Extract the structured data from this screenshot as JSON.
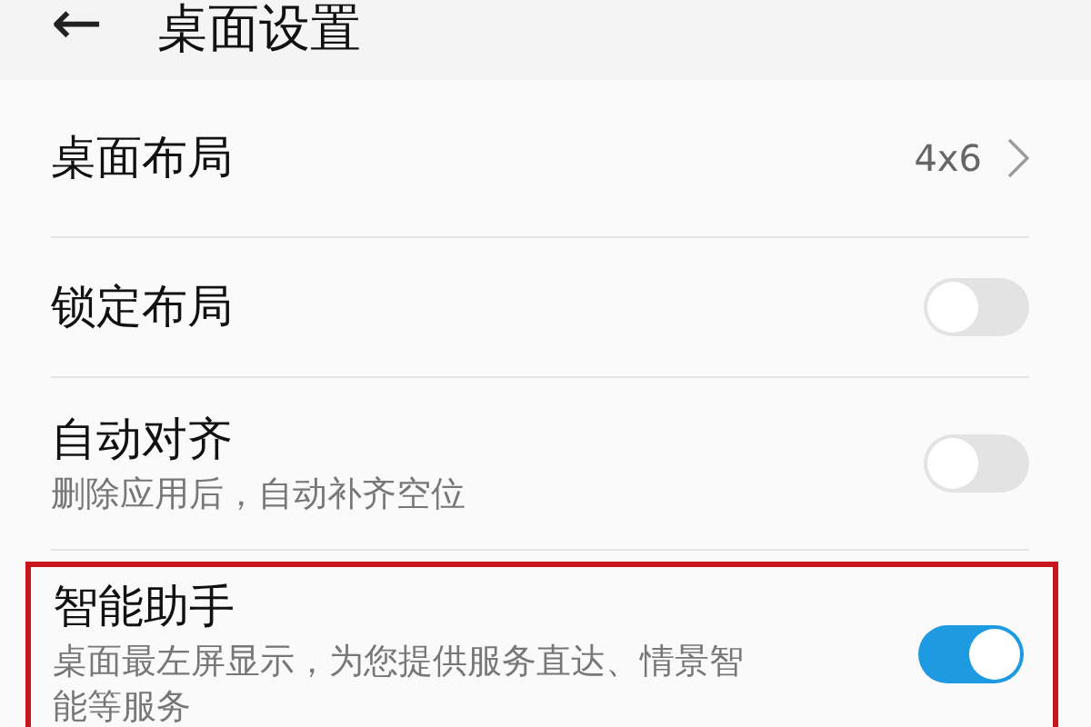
{
  "header": {
    "back": "←",
    "title": "桌面设置"
  },
  "items": [
    {
      "kind": "link",
      "title": "桌面布局",
      "value": "4x6",
      "highlighted": false
    },
    {
      "kind": "switch",
      "title": "锁定布局",
      "on": false,
      "highlighted": false
    },
    {
      "kind": "switch",
      "title": "自动对齐",
      "subtitle": "删除应用后，自动补齐空位",
      "on": false,
      "highlighted": false
    },
    {
      "kind": "switch",
      "title": "智能助手",
      "subtitle": "桌面最左屏显示，为您提供服务直达、情景智能等服务",
      "on": true,
      "highlighted": true
    }
  ]
}
